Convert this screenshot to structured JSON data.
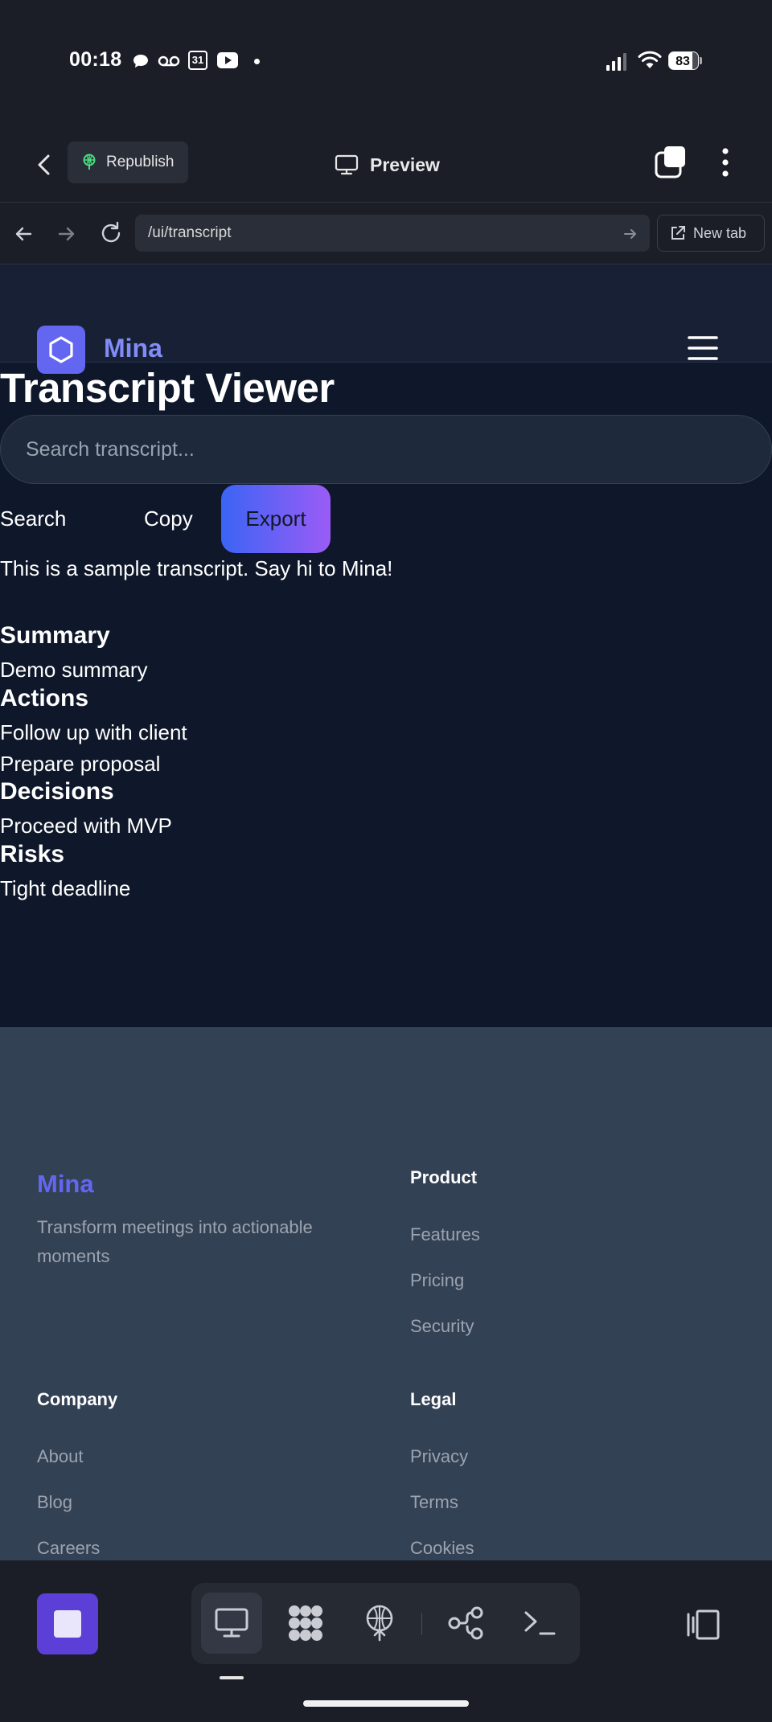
{
  "status_bar": {
    "time": "00:18",
    "battery_level": "83",
    "icons": [
      "speech-bubble-icon",
      "voicemail-icon",
      "calendar-icon",
      "youtube-icon",
      "dot-icon",
      "signal-icon",
      "wifi-icon",
      "battery-icon"
    ],
    "calendar_day": "31"
  },
  "top_bar": {
    "republish_label": "Republish",
    "preview_label": "Preview"
  },
  "browser": {
    "url": "/ui/transcript",
    "new_tab_label": "New tab"
  },
  "site": {
    "brand": "Mina",
    "page_title": "Transcript Viewer",
    "search_placeholder": "Search transcript...",
    "buttons": {
      "search": "Search",
      "copy": "Copy",
      "export": "Export"
    },
    "transcript_text": "This is a sample transcript. Say hi to Mina!",
    "sections": {
      "summary": {
        "heading": "Summary",
        "items": [
          "Demo summary"
        ]
      },
      "actions": {
        "heading": "Actions",
        "items": [
          "Follow up with client",
          "Prepare proposal"
        ]
      },
      "decisions": {
        "heading": "Decisions",
        "items": [
          "Proceed with MVP"
        ]
      },
      "risks": {
        "heading": "Risks",
        "items": [
          "Tight deadline"
        ]
      }
    }
  },
  "footer": {
    "brand": "Mina",
    "tagline": "Transform meetings into actionable moments",
    "product": {
      "heading": "Product",
      "links": [
        "Features",
        "Pricing",
        "Security"
      ]
    },
    "company": {
      "heading": "Company",
      "links": [
        "About",
        "Blog",
        "Careers"
      ]
    },
    "legal": {
      "heading": "Legal",
      "links": [
        "Privacy",
        "Terms",
        "Cookies"
      ]
    }
  },
  "bottom_toolbar": {
    "tools": [
      "preview-icon",
      "agents-icon",
      "deploy-icon",
      "git-icon",
      "shell-icon"
    ],
    "active_tool": "preview-icon"
  },
  "colors": {
    "accent": "#6366f1",
    "page_bg": "#0f172a",
    "footer_bg": "#334155",
    "export_gradient_start": "#3b64f4",
    "export_gradient_end": "#9b5cf6"
  }
}
